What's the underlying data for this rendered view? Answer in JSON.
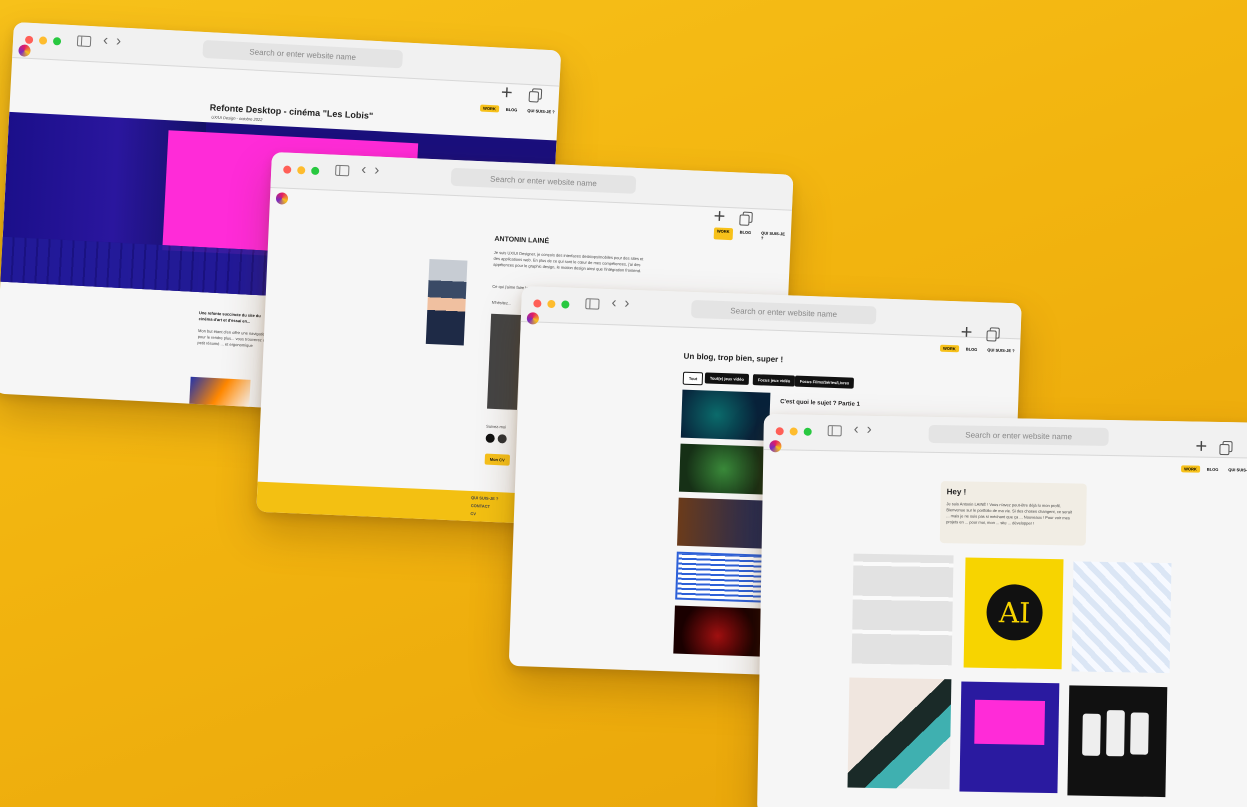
{
  "browser": {
    "address_placeholder": "Search or enter website name"
  },
  "menu": {
    "works": "WORK",
    "blog": "BLOG",
    "about": "QUI SUIS-JE ?"
  },
  "win1": {
    "title": "Refonte Desktop - cinéma \"Les Lobis\"",
    "subtitle": "UX/UI Design - octobre 2022",
    "para_bold": "Une refonte succincte du site du cinéma d'art et d'essai en...",
    "para": "Mon but étant d'en offrir une navigation pour le rendre plus... vous trouverez un petit résumé ... et ergonomique"
  },
  "win2": {
    "name": "ANTONIN LAINÉ",
    "intro": "Je suis UX/UI Designer, je conçois des interfaces desktops/mobiles pour des sites et des applications web. En plus de ce qui sont le cœur de mes compétences, j'ai des appétences pour le graphic design, le motion design ainsi que l'intégration frontend.",
    "more": "Ce qui j'aime faire le plus c'est... et comme les choses du quotidien... le tout est...",
    "extra": "N'hésitez...",
    "follow": "Suivez-moi",
    "cta": "Mon CV",
    "footer": [
      "QUI SUIS-JE ?",
      "CONTACT",
      "CV"
    ]
  },
  "win3": {
    "title": "Un blog, trop bien, super !",
    "filters": [
      "Tout",
      "Tout(e) jeux vidéo",
      "Focus jeux vidéo",
      "Focus Films/Séries/Livres"
    ],
    "post_title": "C'est quoi le sujet ? Partie 1"
  },
  "win4": {
    "greeting": "Hey !",
    "intro": "Je suis Antonin LAINÉ ! Vous n'avez peut-être déjà lu mon profil, Bienvenue sur le portfolio de ma vie. Si des choses changent, ce serait ... mais je ne suis pas si méchant que ça ... Nouveaux ! Pour voir mes projets en ... pour moi, mon ... site ... développer !",
    "tile_text": "AI"
  }
}
